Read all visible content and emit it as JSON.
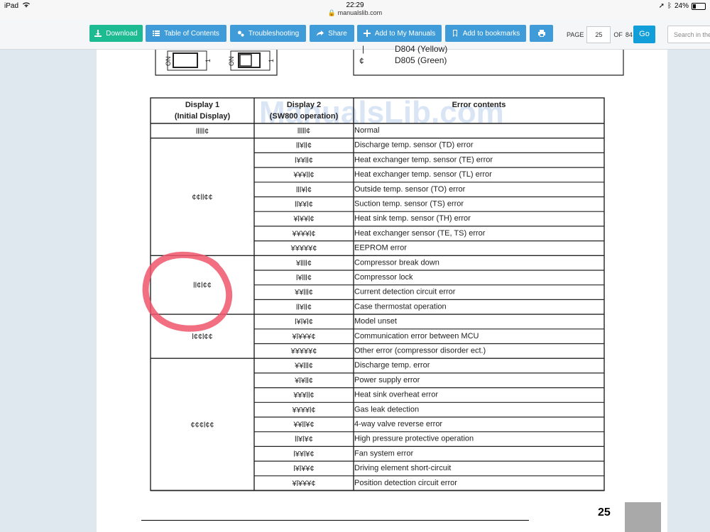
{
  "statusbar": {
    "device": "iPad",
    "time": "22:29",
    "url": "manualslib.com",
    "battery": "24%",
    "battery_level": 0.24
  },
  "toolbar": {
    "download": "Download",
    "toc": "Table of Contents",
    "troubleshooting": "Troubleshooting",
    "share": "Share",
    "add_manuals": "Add to My Manuals",
    "bookmarks": "Add to bookmarks",
    "page_label": "PAGE",
    "page_value": "25",
    "of_label": "OF",
    "total_pages": "84",
    "go": "Go",
    "search_placeholder": "Search in the manual"
  },
  "document": {
    "led_d804": "D804 (Yellow)",
    "led_d805": "D805 (Green)",
    "led_symbol": "¢",
    "switch_on": "ON",
    "switch_one": "1",
    "watermark": "ManualsLib.com",
    "page_number": "25",
    "table": {
      "headers": [
        {
          "line1": "Display 1",
          "line2": "(Initial Display)"
        },
        {
          "line1": "Display 2",
          "line2": "(SW800 operation)"
        },
        {
          "line1": "Error contents",
          "line2": ""
        }
      ],
      "groups": [
        {
          "display1": "lllll¢",
          "rows": [
            {
              "display2": "lllll¢",
              "error": "Normal"
            }
          ]
        },
        {
          "display1": "¢¢ll¢¢",
          "rows": [
            {
              "display2": "ll¥ll¢",
              "error": "Discharge temp. sensor (TD) error"
            },
            {
              "display2": "l¥¥ll¢",
              "error": "Heat exchanger temp. sensor (TE) error"
            },
            {
              "display2": "¥¥¥ll¢",
              "error": "Heat exchanger temp. sensor (TL) error"
            },
            {
              "display2": "lll¥l¢",
              "error": "Outside temp. sensor (TO) error"
            },
            {
              "display2": "ll¥¥l¢",
              "error": "Suction temp. sensor (TS) error"
            },
            {
              "display2": "¥l¥¥l¢",
              "error": "Heat sink temp. sensor (TH) error"
            },
            {
              "display2": "¥¥¥¥l¢",
              "error": "Heat exchanger sensor (TE, TS) error"
            },
            {
              "display2": "¥¥¥¥¥¢",
              "error": "EEPROM error"
            }
          ]
        },
        {
          "display1": "ll¢l¢¢",
          "rows": [
            {
              "display2": "¥llll¢",
              "error": "Compressor break down"
            },
            {
              "display2": "l¥lll¢",
              "error": "Compressor lock"
            },
            {
              "display2": "¥¥lll¢",
              "error": "Current detection circuit error"
            },
            {
              "display2": "ll¥ll¢",
              "error": "Case thermostat operation"
            }
          ]
        },
        {
          "display1": "l¢¢l¢¢",
          "rows": [
            {
              "display2": "l¥l¥l¢",
              "error": "Model unset"
            },
            {
              "display2": "¥l¥¥¥¢",
              "error": "Communication error between MCU"
            },
            {
              "display2": "¥¥¥¥¥¢",
              "error": "Other error (compressor disorder ect.)"
            }
          ]
        },
        {
          "display1": "¢¢¢l¢¢",
          "rows": [
            {
              "display2": "¥¥lll¢",
              "error": "Discharge temp. error"
            },
            {
              "display2": "¥l¥ll¢",
              "error": "Power supply error"
            },
            {
              "display2": "¥¥¥ll¢",
              "error": "Heat sink overheat error"
            },
            {
              "display2": "¥¥¥¥l¢",
              "error": "Gas leak detection"
            },
            {
              "display2": "¥¥ll¥¢",
              "error": "4-way valve reverse error"
            },
            {
              "display2": "ll¥l¥¢",
              "error": "High pressure protective operation"
            },
            {
              "display2": "l¥¥l¥¢",
              "error": "Fan system error"
            },
            {
              "display2": "l¥l¥¥¢",
              "error": "Driving element short-circuit"
            },
            {
              "display2": "¥l¥¥¥¢",
              "error": "Position detection circuit error"
            }
          ]
        }
      ]
    }
  },
  "annotation": {
    "color": "#f0566c"
  },
  "colors": {
    "download": "#1dbb92",
    "buttons": "#3f9cd8",
    "go": "#129ed9"
  }
}
